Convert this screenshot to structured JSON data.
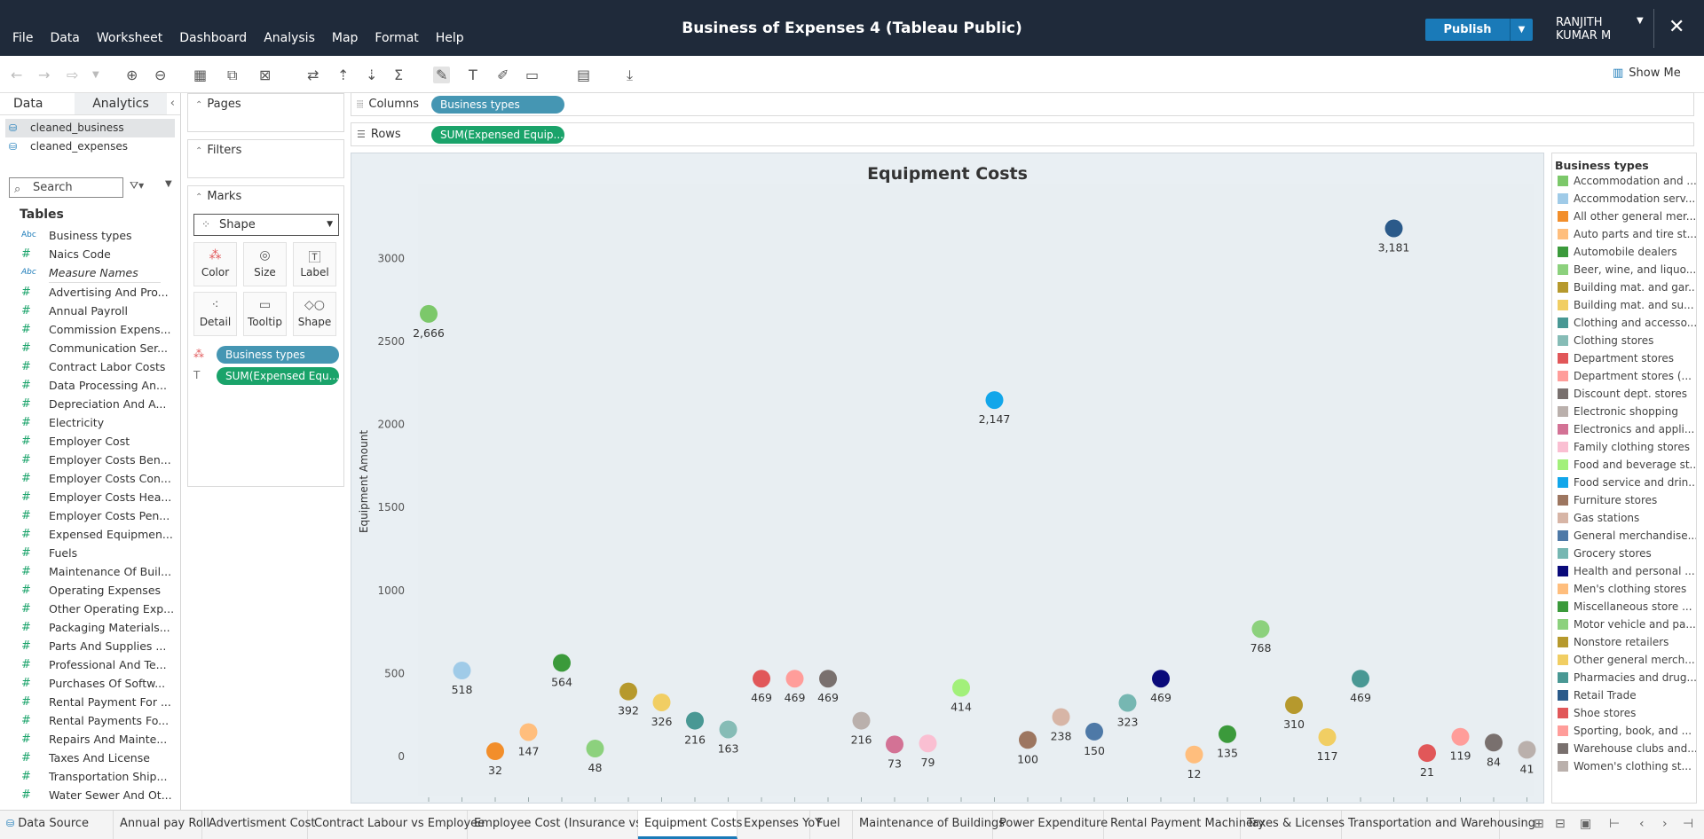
{
  "menu": [
    "File",
    "Data",
    "Worksheet",
    "Dashboard",
    "Analysis",
    "Map",
    "Format",
    "Help"
  ],
  "title": "Business of Expenses 4 (Tableau Public)",
  "publish_label": "Publish",
  "user_name": "RANJITH KUMAR M",
  "show_me": "Show Me",
  "data_tab": "Data",
  "analytics_tab": "Analytics",
  "sources": [
    "cleaned_business",
    "cleaned_expenses"
  ],
  "search_placeholder": "Search",
  "tables_heading": "Tables",
  "dimensions": [
    {
      "name": "Business types",
      "type": "Abc"
    },
    {
      "name": "Naics Code",
      "type": "#"
    },
    {
      "name": "Measure Names",
      "type": "Abc"
    }
  ],
  "measures": [
    "Advertising And Pro...",
    "Annual Payroll",
    "Commission Expens...",
    "Communication Ser...",
    "Contract Labor Costs",
    "Data Processing An...",
    "Depreciation And A...",
    "Electricity",
    "Employer Cost",
    "Employer Costs Ben...",
    "Employer Costs Con...",
    "Employer Costs Hea...",
    "Employer Costs Pen...",
    "Expensed Equipmen...",
    "Fuels",
    "Maintenance Of Buil...",
    "Operating Expenses",
    "Other Operating Exp...",
    "Packaging Materials...",
    "Parts And Supplies ...",
    "Professional And Te...",
    "Purchases Of Softw...",
    "Rental Payment For ...",
    "Rental Payments Fo...",
    "Repairs And Mainte...",
    "Taxes And License",
    "Transportation Ship...",
    "Water Sewer And Ot..."
  ],
  "cards": {
    "pages": "Pages",
    "filters": "Filters",
    "marks": "Marks",
    "mark_type": "Shape",
    "buttons": [
      "Color",
      "Size",
      "Label",
      "Detail",
      "Tooltip",
      "Shape"
    ],
    "color_pill": "Business types",
    "label_pill": "SUM(Expensed Equ..."
  },
  "shelves": {
    "columns_label": "Columns",
    "columns_pill": "Business types",
    "rows_label": "Rows",
    "rows_pill": "SUM(Expensed Equip..."
  },
  "legend_title": "Business types",
  "chart_data": {
    "type": "scatter",
    "title": "Equipment Costs",
    "ylabel": "Equipment Amount",
    "xlabel": "",
    "ylim": [
      0,
      3000
    ],
    "yticks": [
      0,
      500,
      1000,
      1500,
      2000,
      2500,
      3000
    ],
    "points": [
      {
        "category": "Accommodation and ...",
        "value": 2666,
        "label": "2,666",
        "color": "#7cc86a"
      },
      {
        "category": "Accommodation serv...",
        "value": 518,
        "label": "518",
        "color": "#a0cbe8"
      },
      {
        "category": "All other general mer...",
        "value": 32,
        "label": "32",
        "color": "#f28e2b"
      },
      {
        "category": "Auto parts and tire st...",
        "value": 147,
        "label": "147",
        "color": "#ffbe7d"
      },
      {
        "category": "Automobile dealers",
        "value": 564,
        "label": "564",
        "color": "#3b9a3b"
      },
      {
        "category": "Beer, wine, and liquo...",
        "value": 48,
        "label": "48",
        "color": "#8cd17d"
      },
      {
        "category": "Building mat. and gar...",
        "value": 392,
        "label": "392",
        "color": "#b6992d"
      },
      {
        "category": "Building mat. and su...",
        "value": 326,
        "label": "326",
        "color": "#f1ce63"
      },
      {
        "category": "Clothing and accesso...",
        "value": 216,
        "label": "216",
        "color": "#499894"
      },
      {
        "category": "Clothing stores",
        "value": 163,
        "label": "163",
        "color": "#86bcb6"
      },
      {
        "category": "Department stores",
        "value": 469,
        "label": "469",
        "color": "#e15759"
      },
      {
        "category": "Department stores (...",
        "value": 469,
        "label": "469",
        "color": "#ff9d9a"
      },
      {
        "category": "Discount dept. stores",
        "value": 469,
        "label": "469",
        "color": "#79706e"
      },
      {
        "category": "Electronic shopping",
        "value": 216,
        "label": "216",
        "color": "#bab0ac"
      },
      {
        "category": "Electronics and appli...",
        "value": 73,
        "label": "73",
        "color": "#d37295"
      },
      {
        "category": "Family clothing stores",
        "value": 79,
        "label": "79",
        "color": "#fabfd2"
      },
      {
        "category": "Food and beverage st...",
        "value": 414,
        "label": "414",
        "color": "#a2f07a"
      },
      {
        "category": "Food service and drin...",
        "value": 2147,
        "label": "2,147",
        "color": "#12a6ea"
      },
      {
        "category": "Furniture stores",
        "value": 100,
        "label": "100",
        "color": "#9d7660"
      },
      {
        "category": "Gas stations",
        "value": 238,
        "label": "238",
        "color": "#d7b5a6"
      },
      {
        "category": "General merchandise...",
        "value": 150,
        "label": "150",
        "color": "#4e79a7"
      },
      {
        "category": "Grocery stores",
        "value": 323,
        "label": "323",
        "color": "#76b7b2"
      },
      {
        "category": "Health and personal ...",
        "value": 469,
        "label": "469",
        "color": "#0a0a7a"
      },
      {
        "category": "Men's clothing stores",
        "value": 12,
        "label": "12",
        "color": "#ffbe7d"
      },
      {
        "category": "Miscellaneous store ...",
        "value": 135,
        "label": "135",
        "color": "#3b9a3b"
      },
      {
        "category": "Motor vehicle and pa...",
        "value": 768,
        "label": "768",
        "color": "#8cd17d"
      },
      {
        "category": "Nonstore retailers",
        "value": 310,
        "label": "310",
        "color": "#b6992d"
      },
      {
        "category": "Other general merch...",
        "value": 117,
        "label": "117",
        "color": "#f1ce63"
      },
      {
        "category": "Pharmacies and drug...",
        "value": 469,
        "label": "469",
        "color": "#499894"
      },
      {
        "category": "Retail Trade",
        "value": 3181,
        "label": "3,181",
        "color": "#2b5a8a"
      },
      {
        "category": "Shoe stores",
        "value": 21,
        "label": "21",
        "color": "#e15759"
      },
      {
        "category": "Sporting, book, and ...",
        "value": 119,
        "label": "119",
        "color": "#ff9d9a"
      },
      {
        "category": "Warehouse clubs and...",
        "value": 84,
        "label": "84",
        "color": "#79706e"
      },
      {
        "category": "Women's clothing st...",
        "value": 41,
        "label": "41",
        "color": "#bab0ac"
      }
    ]
  },
  "sheet_tabs": [
    "Data Source",
    "Annual pay Roll",
    "Advertisment Cost",
    "Contract Labour vs Employee",
    "Employee Cost (Insurance vs P...",
    "Equipment Costs",
    "Expenses YoY",
    "Fuel",
    "Maintenance of Buildings",
    "Power Expenditure",
    "Rental Payment Machinery",
    "Taxes & Licenses",
    "Transportation and Warehousing"
  ],
  "active_sheet": "Equipment Costs"
}
